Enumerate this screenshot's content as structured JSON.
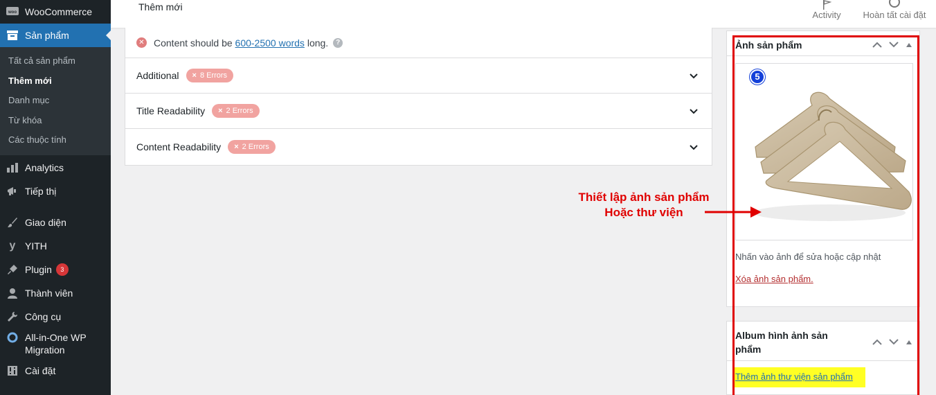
{
  "sidebar": {
    "woocommerce": "WooCommerce",
    "products": "Sản phẩm",
    "submenu": [
      "Tất cả sản phẩm",
      "Thêm mới",
      "Danh mục",
      "Từ khóa",
      "Các thuộc tính"
    ],
    "analytics": "Analytics",
    "marketing": "Tiếp thị",
    "appearance": "Giao diện",
    "yith": "YITH",
    "plugins": "Plugin",
    "plugins_badge": "3",
    "users": "Thành viên",
    "tools": "Công cụ",
    "migration_line1": "All-in-One WP",
    "migration_line2": "Migration",
    "settings": "Cài đặt"
  },
  "topbar": {
    "title": "Thêm mới",
    "activity": "Activity",
    "finish_setup": "Hoàn tất cài đặt"
  },
  "seo": {
    "content_msg_before": "Content should be ",
    "content_msg_link": "600-2500 words",
    "content_msg_after": " long.",
    "rows": [
      {
        "label": "Additional",
        "errors": "8 Errors"
      },
      {
        "label": "Title Readability",
        "errors": "2 Errors"
      },
      {
        "label": "Content Readability",
        "errors": "2 Errors"
      }
    ]
  },
  "product_image_box": {
    "title": "Ảnh sản phẩm",
    "step": "5",
    "hint": "Nhấn vào ảnh để sửa hoặc cập nhật",
    "remove_link": "Xóa ảnh sản phẩm."
  },
  "gallery_box": {
    "title_line1": "Album hình ảnh sản",
    "title_line2": "phẩm",
    "add_link": "Thêm ảnh thư viện sản phẩm"
  },
  "annotation": {
    "line1": "Thiết lập ảnh sản phẩm",
    "line2": "Hoặc thư viện"
  },
  "colors": {
    "sidebar_bg": "#1d2327",
    "active_menu": "#2271b1",
    "annotation_red": "#e00000",
    "highlight_yellow": "#ffff24",
    "error_pill": "#f1a3a0"
  }
}
